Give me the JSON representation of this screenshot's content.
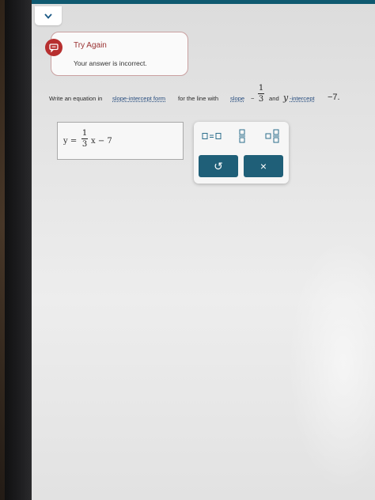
{
  "header": {
    "collapse_icon": "chevron-down-icon",
    "accent": "#0f5970"
  },
  "feedback": {
    "icon": "feedback-icon",
    "title": "Try Again",
    "message": "Your answer is incorrect.",
    "color": "#b72f2f"
  },
  "question": {
    "prefix": "Write an equation in",
    "link_form": "slope-intercept form",
    "middle": "for the line with",
    "link_slope": "slope",
    "slope_sign": "−",
    "slope_num": "1",
    "slope_den": "3",
    "and": "and",
    "y_letter": "y",
    "link_intercept": "-intercept",
    "intercept_value": "−7."
  },
  "answer": {
    "lhs": "y =",
    "frac_num": "1",
    "frac_den": "3",
    "rhs": "x − 7"
  },
  "keypad": {
    "tool_equals": "equation-template-icon",
    "tool_fraction": "fraction-template-icon",
    "tool_mixed": "mixed-number-template-icon",
    "undo_label": "↺",
    "clear_label": "×",
    "button_color": "#1f5f78"
  }
}
